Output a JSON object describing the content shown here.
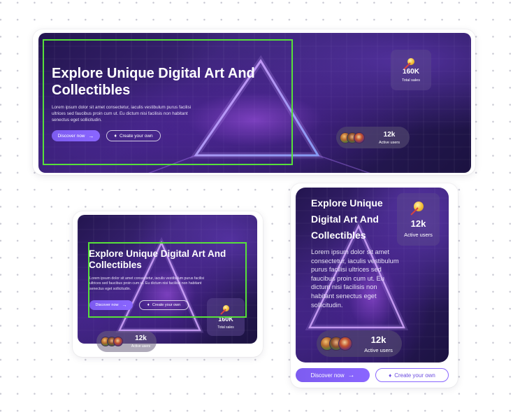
{
  "hero": {
    "title": "Explore Unique Digital Art And Collectibles",
    "description": "Lorem ipsum dolor sit amet consectetur, iaculis vestibulum purus facilisi ultrices sed faucibus proin cum ut. Eu dictum nisi facilisis non habitant senectus eget sollicitudin.",
    "discover_label": "Discover now",
    "create_label": "Create your own",
    "total_sales_value": "160K",
    "total_sales_label": "Total sales",
    "active_users_value": "12k",
    "active_users_label": "Active users"
  },
  "colors": {
    "accent": "#8a66ff",
    "highlight_box": "#57e03a",
    "hero_bg": "#2a1a5c"
  },
  "icons": [
    "arrow-right-icon",
    "diamond-icon",
    "coin-wand-icon"
  ]
}
